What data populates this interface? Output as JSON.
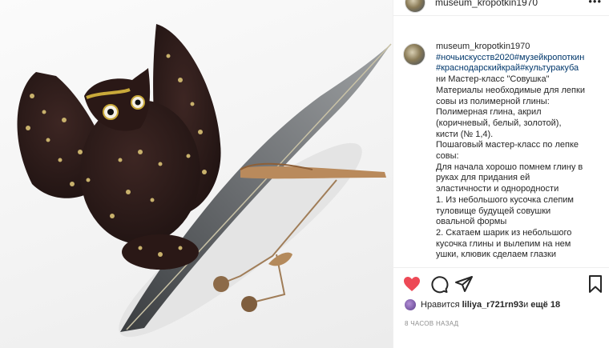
{
  "header": {
    "username": "museum_kropotkin1970",
    "more_icon": "more-horizontal-icon"
  },
  "caption": {
    "username": "museum_kropotkin1970",
    "tags_line1": "#ночьискусств2020#музейкропоткин",
    "tags_line2": "#краснодарскийкрай#культуракуба",
    "lines": [
      "ни Мастер-класс \"Совушка\"",
      "Материалы необходимые для лепки",
      "совы из полимерной глины:",
      "Полимерная глина, акрил",
      "(коричневый, белый, золотой),",
      "кисти (№ 1,4).",
      "Пошаговый мастер-класс по лепке",
      "совы:",
      "Для начала хорошо помнем глину в",
      "руках для придания ей",
      "эластичности и однородности",
      "1. Из небольшого кусочка слепим",
      "туловище будущей совушки",
      "овальной формы",
      "2. Скатаем шарик из небольшого",
      "кусочка глины и вылепим на нем",
      "ушки, клювик сделаем глазки"
    ]
  },
  "actions": {
    "like_icon": "heart-icon",
    "comment_icon": "comment-icon",
    "share_icon": "share-icon",
    "save_icon": "bookmark-icon",
    "like_color": "#ed4956"
  },
  "likes": {
    "prefix": "Нравится ",
    "user": "liliya_r721rn93",
    "middle": " и ",
    "others": "ещё 18"
  },
  "timestamp": "8 ЧАСОВ НАЗАД"
}
